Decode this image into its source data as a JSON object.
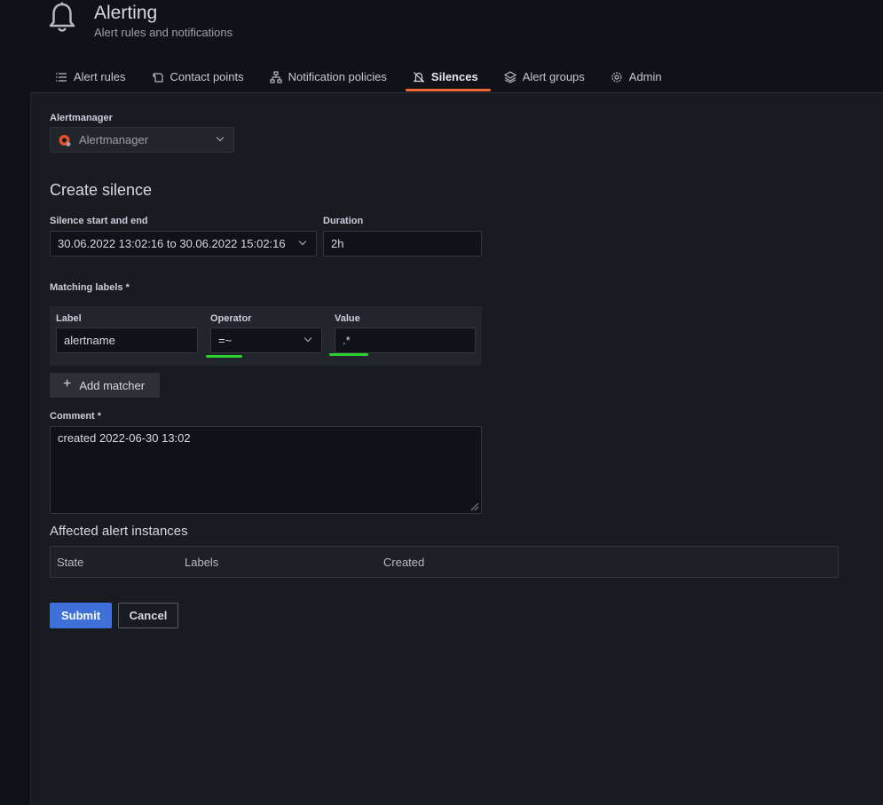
{
  "header": {
    "title": "Alerting",
    "subtitle": "Alert rules and notifications"
  },
  "tabs": [
    {
      "label": "Alert rules",
      "icon": "list-icon"
    },
    {
      "label": "Contact points",
      "icon": "contact-icon"
    },
    {
      "label": "Notification policies",
      "icon": "sitemap-icon"
    },
    {
      "label": "Silences",
      "icon": "bell-slash-icon",
      "active": true
    },
    {
      "label": "Alert groups",
      "icon": "layers-icon"
    },
    {
      "label": "Admin",
      "icon": "cog-icon"
    }
  ],
  "alertmanager": {
    "label": "Alertmanager",
    "value": "Alertmanager"
  },
  "form": {
    "heading": "Create silence",
    "range_label": "Silence start and end",
    "range_value": "30.06.2022 13:02:16 to 30.06.2022 15:02:16",
    "duration_label": "Duration",
    "duration_value": "2h",
    "matching_labels": "Matching labels *",
    "matcher": {
      "label_header": "Label",
      "operator_header": "Operator",
      "value_header": "Value",
      "label_value": "alertname",
      "operator_value": "=~",
      "value_value": ".*"
    },
    "add_matcher": "Add matcher",
    "comment_label": "Comment *",
    "comment_value": "created 2022-06-30 13:02"
  },
  "affected": {
    "heading": "Affected alert instances",
    "columns": [
      "State",
      "Labels",
      "Created"
    ]
  },
  "actions": {
    "submit": "Submit",
    "cancel": "Cancel"
  },
  "colors": {
    "accent": "#f06a36",
    "primary": "#3d71d9",
    "highlight": "#2ed22e"
  }
}
